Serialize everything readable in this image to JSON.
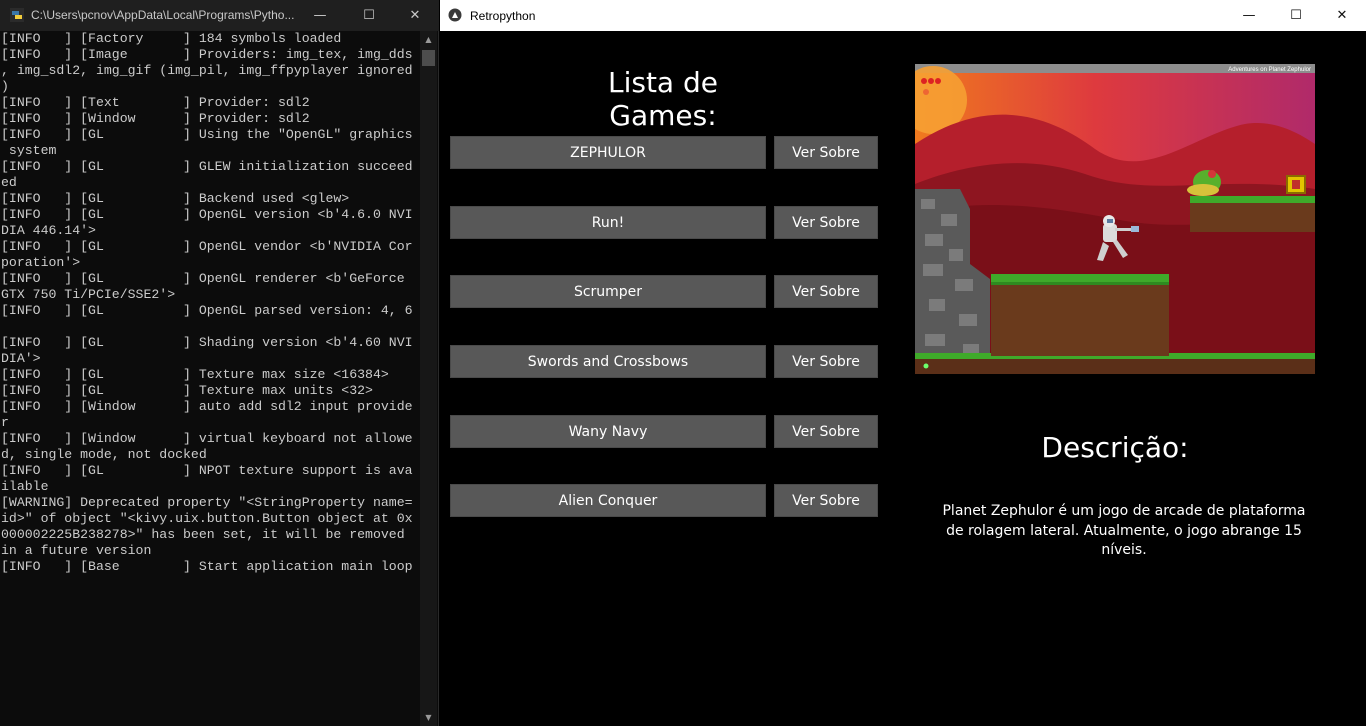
{
  "console": {
    "title": "C:\\Users\\pcnov\\AppData\\Local\\Programs\\Pytho...",
    "controls": {
      "minimize": "—",
      "maximize": "☐",
      "close": "✕"
    },
    "lines": [
      "[INFO   ] [Factory     ] 184 symbols loaded",
      "[INFO   ] [Image       ] Providers: img_tex, img_dds",
      ", img_sdl2, img_gif (img_pil, img_ffpyplayer ignored",
      ")",
      "[INFO   ] [Text        ] Provider: sdl2",
      "[INFO   ] [Window      ] Provider: sdl2",
      "[INFO   ] [GL          ] Using the \"OpenGL\" graphics",
      " system",
      "[INFO   ] [GL          ] GLEW initialization succeed",
      "ed",
      "[INFO   ] [GL          ] Backend used <glew>",
      "[INFO   ] [GL          ] OpenGL version <b'4.6.0 NVI",
      "DIA 446.14'>",
      "[INFO   ] [GL          ] OpenGL vendor <b'NVIDIA Cor",
      "poration'>",
      "[INFO   ] [GL          ] OpenGL renderer <b'GeForce ",
      "GTX 750 Ti/PCIe/SSE2'>",
      "[INFO   ] [GL          ] OpenGL parsed version: 4, 6",
      "",
      "[INFO   ] [GL          ] Shading version <b'4.60 NVI",
      "DIA'>",
      "[INFO   ] [GL          ] Texture max size <16384>",
      "[INFO   ] [GL          ] Texture max units <32>",
      "[INFO   ] [Window      ] auto add sdl2 input provide",
      "r",
      "[INFO   ] [Window      ] virtual keyboard not allowe",
      "d, single mode, not docked",
      "[INFO   ] [GL          ] NPOT texture support is ava",
      "ilable",
      "[WARNING] Deprecated property \"<StringProperty name=",
      "id>\" of object \"<kivy.uix.button.Button object at 0x",
      "000002225B238278>\" has been set, it will be removed",
      "in a future version",
      "[INFO   ] [Base        ] Start application main loop"
    ]
  },
  "app": {
    "title": "Retropython",
    "controls": {
      "minimize": "—",
      "maximize": "☐",
      "close": "✕"
    },
    "list_title": "Lista de Games:",
    "games": [
      {
        "name": "ZEPHULOR",
        "about_label": "Ver Sobre"
      },
      {
        "name": "Run!",
        "about_label": "Ver Sobre"
      },
      {
        "name": "Scrumper",
        "about_label": "Ver Sobre"
      },
      {
        "name": "Swords and Crossbows",
        "about_label": "Ver Sobre"
      },
      {
        "name": "Wany Navy",
        "about_label": "Ver Sobre"
      },
      {
        "name": "Alien Conquer",
        "about_label": "Ver Sobre"
      }
    ],
    "preview": {
      "caption": "Adventures on Planet Zephulor"
    },
    "description_title": "Descrição:",
    "description_text": "Planet Zephulor é um jogo de arcade de plataforma de rolagem lateral. Atualmente, o jogo abrange 15 níveis."
  },
  "colors": {
    "console_bg": "#0c0c0c",
    "console_text": "#cccccc",
    "button_bg": "#585858",
    "app_bg": "#000000"
  }
}
